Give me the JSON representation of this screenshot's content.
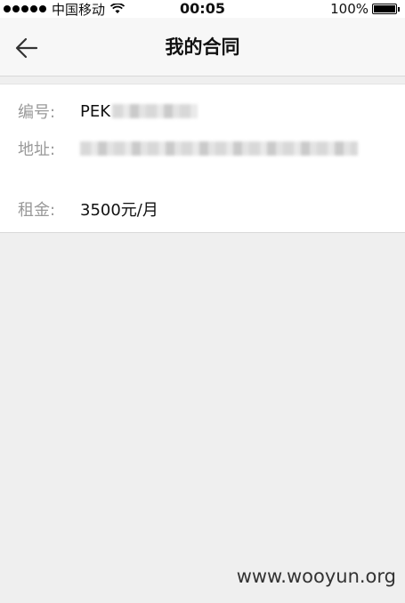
{
  "status_bar": {
    "carrier": "中国移动",
    "time": "00:05",
    "battery": "100%"
  },
  "nav": {
    "title": "我的合同"
  },
  "contract": {
    "number_label": "编号:",
    "number_value": "PEK",
    "address_label": "地址:",
    "rent_label": "租金:",
    "rent_value": "3500元/月"
  },
  "watermark": "www.wooyun.org"
}
